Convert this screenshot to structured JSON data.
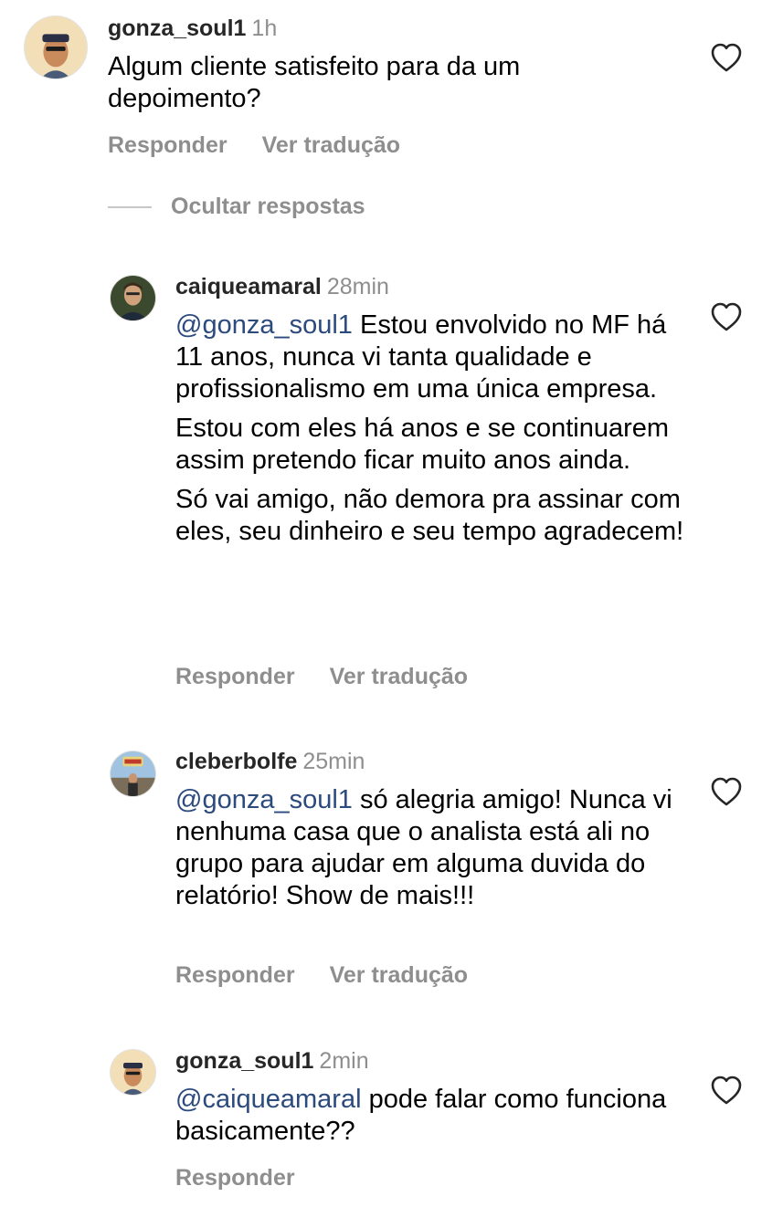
{
  "comments": [
    {
      "username": "gonza_soul1",
      "time": "1h",
      "paragraphs": [
        {
          "mention": "",
          "text": "Algum cliente satisfeito para da um depoimento?"
        }
      ],
      "actions": {
        "reply": "Responder",
        "translate": "Ver tradução"
      },
      "icons": {
        "avatar": "profile-photo",
        "like": "heart-outline-icon"
      }
    },
    {
      "username": "caiqueamaral",
      "time": "28min",
      "paragraphs": [
        {
          "mention": "@gonza_soul1",
          "text": " Estou envolvido no MF há 11 anos, nunca vi tanta qualidade e profissionalismo em uma única empresa."
        },
        {
          "mention": "",
          "text": "Estou com eles há anos e se continuarem assim pretendo ficar muito anos ainda."
        },
        {
          "mention": "",
          "text": "Só vai amigo, não demora pra assinar com eles, seu dinheiro e seu tempo agradecem!"
        }
      ],
      "actions": {
        "reply": "Responder",
        "translate": "Ver tradução"
      },
      "icons": {
        "avatar": "profile-photo",
        "like": "heart-outline-icon"
      }
    },
    {
      "username": "cleberbolfe",
      "time": "25min",
      "paragraphs": [
        {
          "mention": "@gonza_soul1",
          "text": " só alegria amigo! Nunca vi nenhuma casa que o analista está ali no grupo para ajudar em alguma duvida do relatório! Show de mais!!!"
        }
      ],
      "actions": {
        "reply": "Responder",
        "translate": "Ver tradução"
      },
      "icons": {
        "avatar": "profile-photo",
        "like": "heart-outline-icon"
      }
    },
    {
      "username": "gonza_soul1",
      "time": "2min",
      "paragraphs": [
        {
          "mention": "@caiqueamaral",
          "text": " pode falar como funciona basicamente??"
        }
      ],
      "actions": {
        "reply": "Responder"
      },
      "icons": {
        "avatar": "profile-photo",
        "like": "heart-outline-icon"
      }
    }
  ],
  "replies_toggle": {
    "label": "Ocultar respostas"
  },
  "colors": {
    "mention": "#2b4a7d",
    "secondary_text": "#8e8e8e",
    "username": "#262626"
  }
}
